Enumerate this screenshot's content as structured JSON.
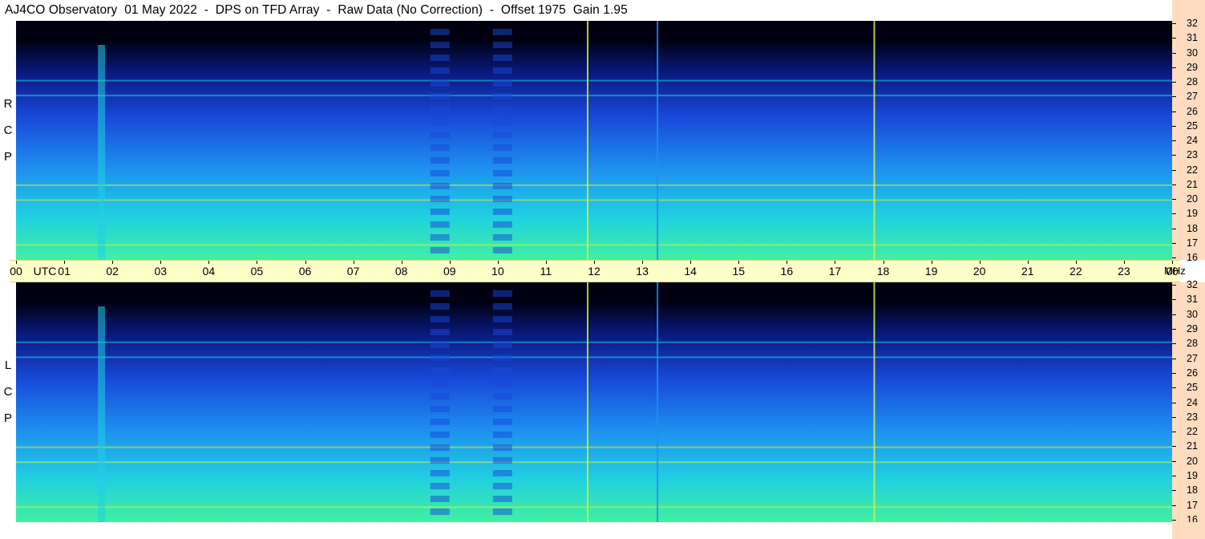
{
  "title": "AJ4CO Observatory  01 May 2022  -  DPS on TFD Array  -  Raw Data (No Correction)  -  Offset 1975  Gain 1.95",
  "chart_data": {
    "type": "heatmap",
    "title": "AJ4CO Observatory  01 May 2022  -  DPS on TFD Array  -  Raw Data (No Correction)  -  Offset 1975  Gain 1.95",
    "panels": [
      {
        "name": "RCP",
        "side_label": [
          "R",
          "C",
          "P"
        ]
      },
      {
        "name": "LCP",
        "side_label": [
          "L",
          "C",
          "P"
        ]
      }
    ],
    "x_axis": {
      "unit_label": "UTC",
      "ticks": [
        "00",
        "01",
        "02",
        "03",
        "04",
        "05",
        "06",
        "07",
        "08",
        "09",
        "10",
        "11",
        "12",
        "13",
        "14",
        "15",
        "16",
        "17",
        "18",
        "19",
        "20",
        "21",
        "22",
        "23",
        "00"
      ],
      "range_hours": [
        0,
        24
      ]
    },
    "y_axis": {
      "unit_label": "MHz",
      "ticks": [
        16,
        17,
        18,
        19,
        20,
        21,
        22,
        23,
        24,
        25,
        26,
        27,
        28,
        29,
        30,
        31,
        32
      ],
      "range": [
        16,
        32
      ]
    },
    "colormap": [
      "#000010",
      "#0a1a80",
      "#1848d8",
      "#1e90f0",
      "#20d0e0",
      "#40f0a0",
      "#d0f040",
      "#f0a020",
      "#f03020"
    ],
    "features": {
      "vertical_lines_utc": [
        11.85,
        13.3,
        17.8
      ],
      "broadband_bursts_utc": [
        [
          1.7,
          1.85
        ]
      ],
      "banded_columns_utc": [
        [
          8.6,
          9.0
        ],
        [
          9.9,
          10.3
        ]
      ],
      "rfi_lines_mhz": [
        17.0,
        20.0,
        21.0,
        27.0,
        28.0
      ]
    }
  }
}
